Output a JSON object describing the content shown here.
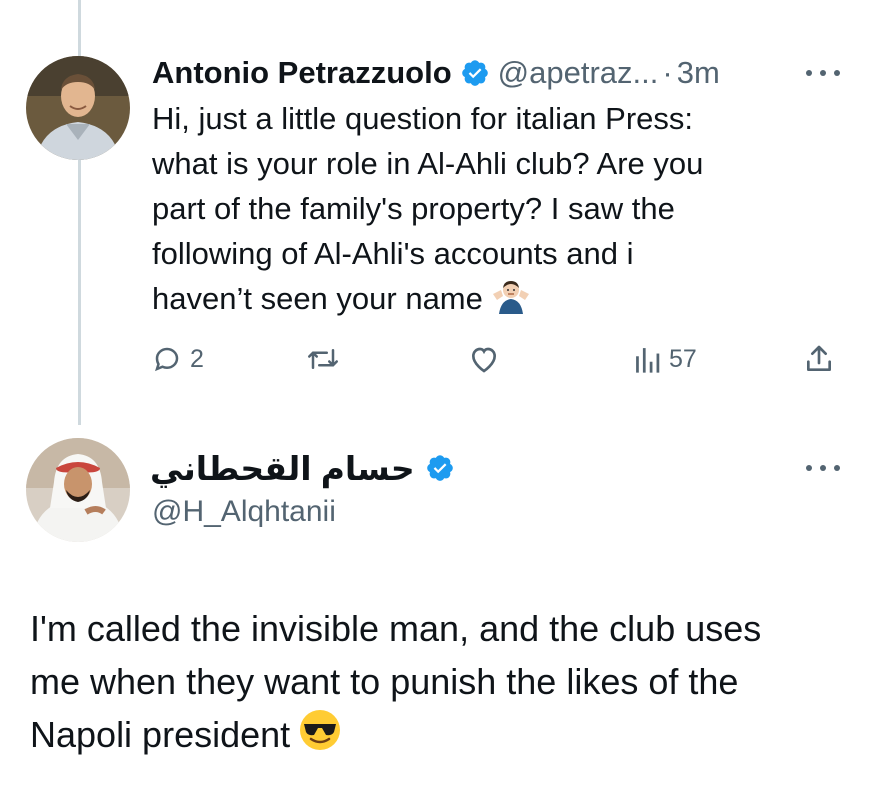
{
  "original_tweet": {
    "author_name": "Antonio Petrazzuolo",
    "handle": "@apetraz...",
    "separator": "·",
    "time": "3m",
    "verified_badge_color": "#1d9bf0",
    "text_lines": [
      "Hi, just a little question for italian Press:",
      "what is your role in Al-Ahli club? Are you",
      "part of the family's property? I saw the",
      "following of Al-Ahli's accounts and i",
      "haven’t seen your name"
    ],
    "trailing_emoji": "person-shrugging-emoji",
    "actions": {
      "reply_count": "2",
      "retweet_count": "",
      "like_count": "",
      "views_count": "57"
    }
  },
  "reply_tweet": {
    "author_name": "حسام القحطاني",
    "handle": "@H_Alqhtanii",
    "verified_badge_color": "#1d9bf0",
    "text_lines": [
      "I'm called the invisible man, and the club uses",
      "me when they want to punish the likes of the",
      "Napoli president"
    ],
    "trailing_emoji": "smiling-face-with-sunglasses-emoji"
  },
  "colors": {
    "text_primary": "#0f1419",
    "text_secondary": "#536471",
    "thread_line": "#cfd9de",
    "accent": "#1d9bf0"
  }
}
